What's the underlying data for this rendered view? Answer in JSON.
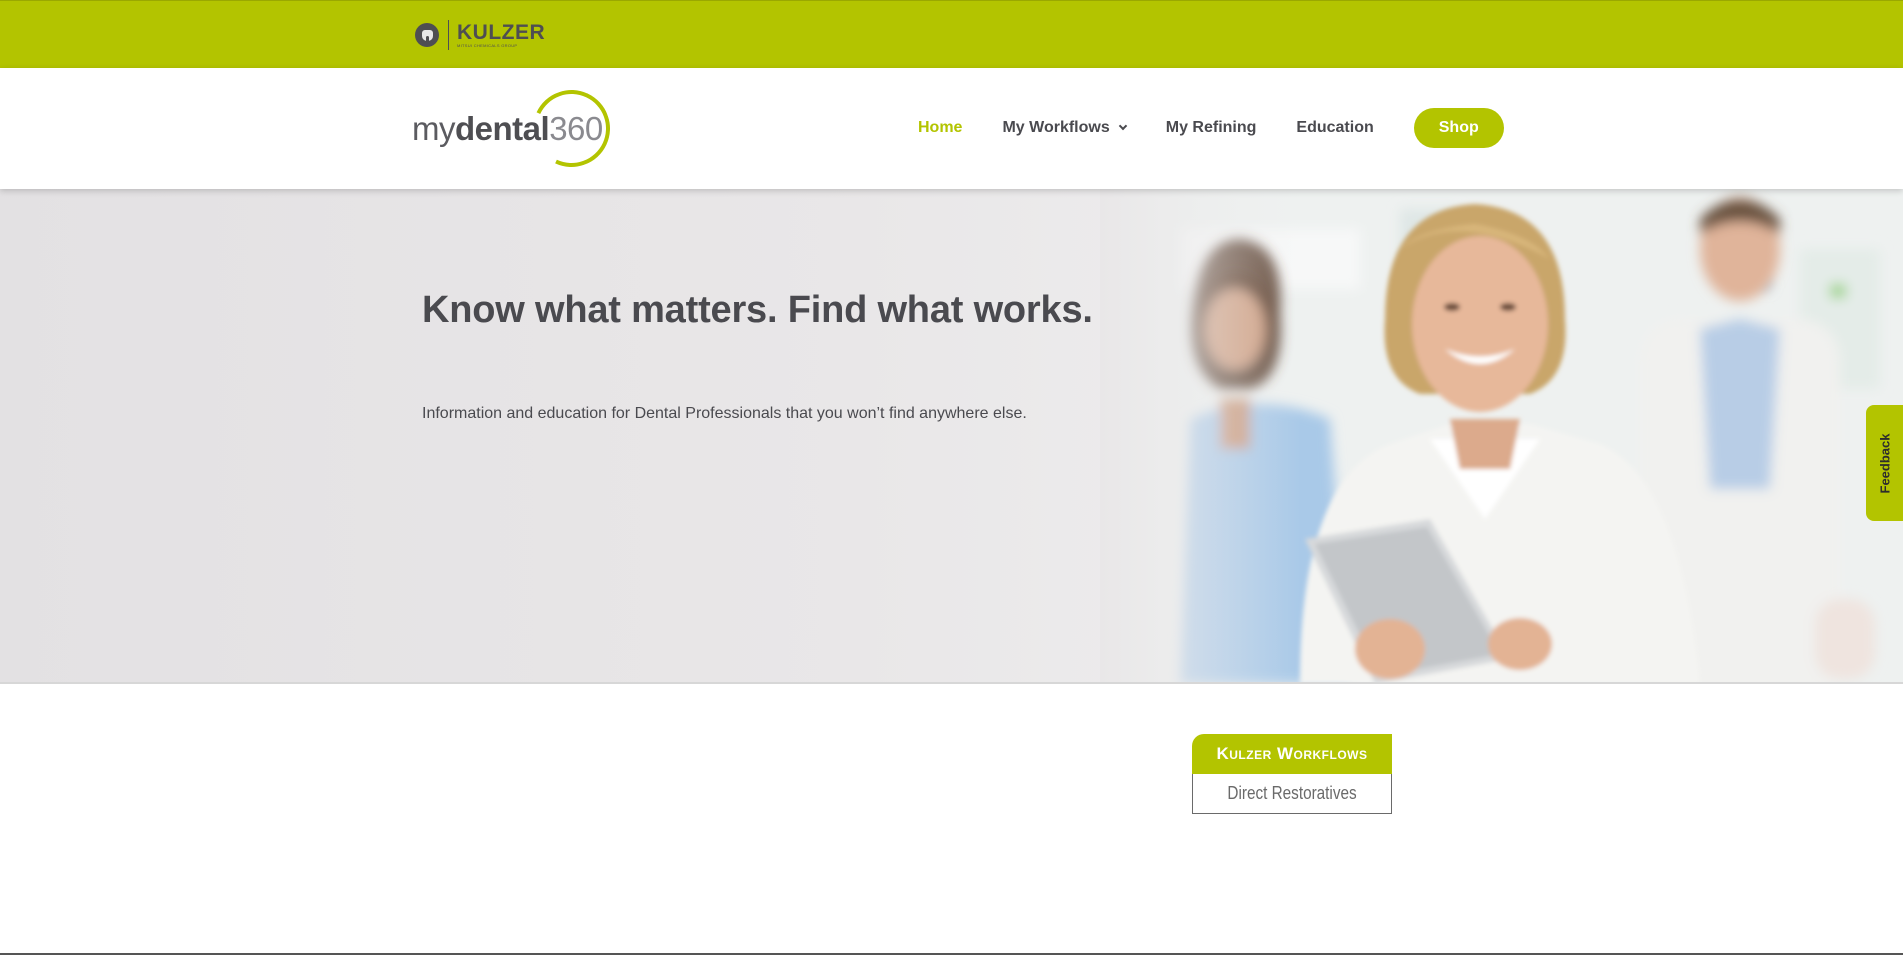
{
  "brand": {
    "company_name": "KULZER",
    "company_tagline": "MITSUI CHEMICALS GROUP",
    "site_logo": {
      "my": "my",
      "dental": "dental",
      "number": "360"
    }
  },
  "nav": {
    "items": [
      {
        "label": "Home",
        "active": true
      },
      {
        "label": "My Workflows",
        "dropdown": true
      },
      {
        "label": "My Refining"
      },
      {
        "label": "Education"
      }
    ],
    "shop_label": "Shop"
  },
  "hero": {
    "title": "Know what matters. Find what works.",
    "subtitle": "Information and education for Dental Professionals that you won’t find anywhere else."
  },
  "feedback_label": "Feedback",
  "workflows_card": {
    "title": "Kulzer Workflows",
    "items": [
      "Direct Restoratives"
    ]
  },
  "colors": {
    "accent": "#b3c400",
    "text": "#4a4a4f",
    "scrub_blue": "#a9c9e8",
    "coat_white": "#f4f4f2"
  }
}
